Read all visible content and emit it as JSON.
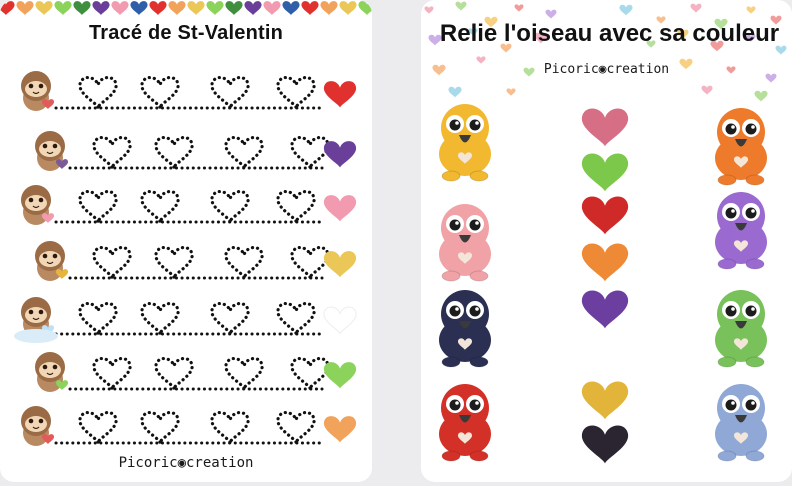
{
  "left_sheet": {
    "title": "Tracé de St-Valentin",
    "brand": "Picoric◉creation",
    "rows": [
      {
        "end_heart_color": "#e0312e",
        "character": "sloth-love-letter"
      },
      {
        "end_heart_color": "#6a3f9a",
        "character": "sloth-balloons"
      },
      {
        "end_heart_color": "#f29bb0",
        "character": "sloth-pink-balloons"
      },
      {
        "end_heart_color": "#ebc757",
        "character": "sloth-cupid-bow"
      },
      {
        "end_heart_color": "#ffffff",
        "character": "sloth-cloud-angel"
      },
      {
        "end_heart_color": "#8bd35a",
        "character": "sloth-gift-box"
      },
      {
        "end_heart_color": "#f2a35b",
        "character": "sloth-heart"
      }
    ]
  },
  "right_sheet": {
    "title": "Relie l'oiseau avec sa couleur",
    "brand": "Picoric◉creation",
    "middle_hearts": [
      "#d66f86",
      "#7cc84a",
      "#cf2a28",
      "#ee8a35",
      "#6b3ea0",
      "#e2b43a",
      "#2a2530"
    ],
    "left_birds": [
      {
        "color": "#f1b830",
        "name": "yellow-bird"
      },
      {
        "color": "#f0a2a6",
        "name": "pink-bird"
      },
      {
        "color": "#2b2f52",
        "name": "navy-bird"
      },
      {
        "color": "#d33128",
        "name": "red-bird"
      }
    ],
    "right_birds": [
      {
        "color": "#ee7b2b",
        "name": "orange-bird"
      },
      {
        "color": "#9a6ad0",
        "name": "purple-bird"
      },
      {
        "color": "#79c15a",
        "name": "green-bird"
      },
      {
        "color": "#8fa8d6",
        "name": "blue-bird"
      }
    ]
  },
  "palette": [
    "#e0312e",
    "#f2a35b",
    "#ebc757",
    "#8bd35a",
    "#3f8f3f",
    "#6a3f9a",
    "#f29bb0",
    "#2f5fa8"
  ]
}
